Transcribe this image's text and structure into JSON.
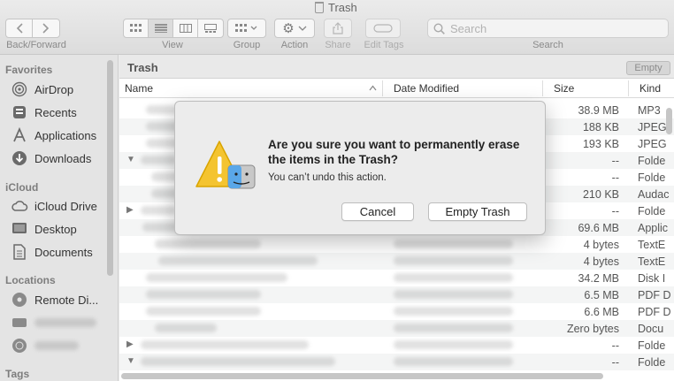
{
  "window": {
    "title": "Trash"
  },
  "toolbar": {
    "back_forward_label": "Back/Forward",
    "view_label": "View",
    "group_label": "Group",
    "action_label": "Action",
    "share_label": "Share",
    "edit_tags_label": "Edit Tags",
    "search_placeholder": "Search",
    "search_label": "Search"
  },
  "sidebar": {
    "favorites_header": "Favorites",
    "favorites": [
      {
        "label": "AirDrop",
        "icon": "airdrop-icon"
      },
      {
        "label": "Recents",
        "icon": "recents-icon"
      },
      {
        "label": "Applications",
        "icon": "applications-icon"
      },
      {
        "label": "Downloads",
        "icon": "downloads-icon"
      }
    ],
    "icloud_header": "iCloud",
    "icloud": [
      {
        "label": "iCloud Drive",
        "icon": "cloud-icon"
      },
      {
        "label": "Desktop",
        "icon": "desktop-icon"
      },
      {
        "label": "Documents",
        "icon": "documents-icon"
      }
    ],
    "locations_header": "Locations",
    "locations": [
      {
        "label": "Remote Di...",
        "icon": "remote-disc-icon"
      }
    ],
    "tags_header": "Tags"
  },
  "main": {
    "path_label": "Trash",
    "empty_button": "Empty",
    "columns": {
      "name": "Name",
      "date": "Date Modified",
      "size": "Size",
      "kind": "Kind"
    },
    "rows": [
      {
        "size": "38.9 MB",
        "kind": "MP3"
      },
      {
        "size": "188 KB",
        "kind": "JPEG"
      },
      {
        "size": "193 KB",
        "kind": "JPEG"
      },
      {
        "size": "--",
        "kind": "Folde"
      },
      {
        "size": "--",
        "kind": "Folde"
      },
      {
        "size": "210 KB",
        "kind": "Audac"
      },
      {
        "size": "--",
        "kind": "Folde"
      },
      {
        "size": "69.6 MB",
        "kind": "Applic"
      },
      {
        "size": "4 bytes",
        "kind": "TextE"
      },
      {
        "size": "4 bytes",
        "kind": "TextE"
      },
      {
        "size": "34.2 MB",
        "kind": "Disk I"
      },
      {
        "size": "6.5 MB",
        "kind": "PDF D"
      },
      {
        "size": "6.6 MB",
        "kind": "PDF D"
      },
      {
        "size": "Zero bytes",
        "kind": "Docu"
      },
      {
        "size": "--",
        "kind": "Folde"
      },
      {
        "size": "--",
        "kind": "Folde"
      }
    ]
  },
  "dialog": {
    "title": "Are you sure you want to permanently erase the items in the Trash?",
    "message": "You can’t undo this action.",
    "cancel_label": "Cancel",
    "confirm_label": "Empty Trash"
  }
}
